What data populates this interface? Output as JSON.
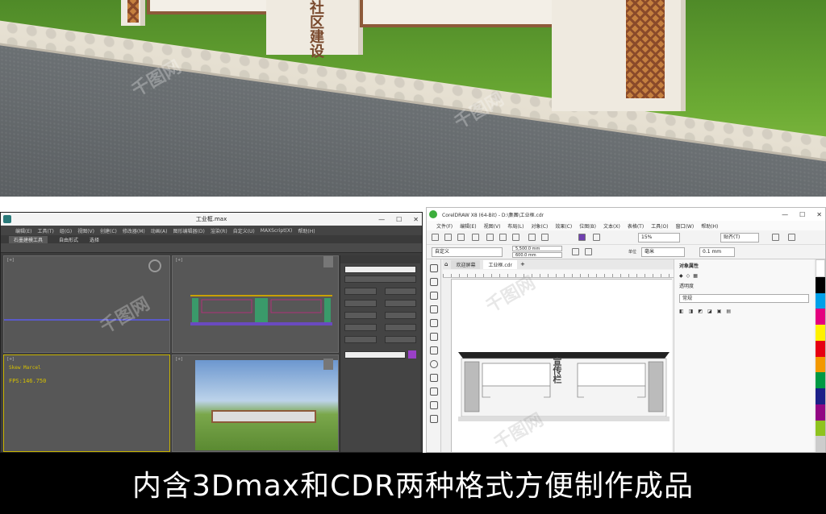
{
  "caption": "内含3Dmax和CDR两种格式方便制作成品",
  "watermark": "千图网",
  "scene": {
    "signage_calligraphy": "社区建设"
  },
  "max": {
    "title": "工业框.max",
    "menu": [
      "编辑(E)",
      "工具(T)",
      "组(G)",
      "视图(V)",
      "创建(C)",
      "修改器(M)",
      "动画(A)",
      "图形编辑器(D)",
      "渲染(R)",
      "自定义(U)",
      "MAXScript(X)",
      "帮助(H)"
    ],
    "ribbon": [
      "石墨建模工具",
      "自由形式",
      "选择"
    ],
    "fps": "FPS:146.750",
    "viewport_text": "Skew Marcel"
  },
  "cdr": {
    "title": "CorelDRAW X8 (64-Bit) - D:\\集團\\工业框.cdr",
    "menu": [
      "文件(F)",
      "编辑(E)",
      "视图(V)",
      "布局(L)",
      "对象(C)",
      "效果(C)",
      "位图(B)",
      "文本(X)",
      "表格(T)",
      "工具(O)",
      "窗口(W)",
      "帮助(H)"
    ],
    "preset": "自定义",
    "width": "5,500.0 mm",
    "height": "600.0 mm",
    "zoom": "15%",
    "snap": "贴齐(T)",
    "units_label": "单位",
    "units": "毫米",
    "nudge": "0.1 mm",
    "tabs": [
      "欢迎屏幕",
      "工业框.cdr"
    ],
    "props_title": "对象属性",
    "props_subtitle": "透明度",
    "props_value": "常规",
    "drawing_text": "宣传栏"
  },
  "colors": {
    "caption_bg": "#000000",
    "caption_fg": "#ffffff",
    "max_bg": "#3d3d3d",
    "wood": "#8d5a3a"
  }
}
